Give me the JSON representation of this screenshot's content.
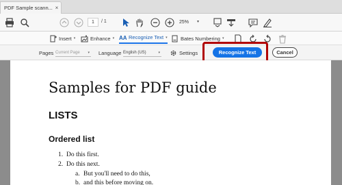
{
  "tab": {
    "label": "PDF Sample scann...",
    "close": "×"
  },
  "toolbar": {
    "page_current": "1",
    "page_total": "/ 1",
    "zoom": "25%"
  },
  "ocr_toolbar": {
    "insert": "Insert",
    "enhance": "Enhance",
    "recognize_text": "Recognize Text",
    "bates": "Bates Numbering"
  },
  "settings_row": {
    "pages_label": "Pages",
    "pages_value": "Current Page",
    "language_label": "Language",
    "language_value": "English (US)",
    "settings_label": "Settings",
    "recognize_button": "Recognize Text",
    "cancel_button": "Cancel"
  },
  "document": {
    "title": "Samples for PDF guide",
    "heading_lists": "LISTS",
    "heading_ordered": "Ordered list",
    "items": [
      {
        "marker": "1.",
        "text": "Do this first."
      },
      {
        "marker": "2.",
        "text": "Do this next."
      },
      {
        "marker": "a.",
        "text": "But you'll need to do this,"
      },
      {
        "marker": "b.",
        "text": "and this before moving on."
      }
    ]
  },
  "colors": {
    "accent": "#1473e6",
    "highlight": "#b00000"
  },
  "icons": [
    "print-icon",
    "zoom-search-icon",
    "prev-page-icon",
    "next-page-icon",
    "select-cursor-icon",
    "hand-icon",
    "zoom-out-icon",
    "zoom-in-icon",
    "fit-page-icon",
    "scroll-mode-icon",
    "comment-icon",
    "sign-icon",
    "insert-page-icon",
    "enhance-icon",
    "recognize-text-icon",
    "bates-icon",
    "doc-icon",
    "rotate-left-icon",
    "rotate-right-icon",
    "trash-icon",
    "gear-icon"
  ]
}
